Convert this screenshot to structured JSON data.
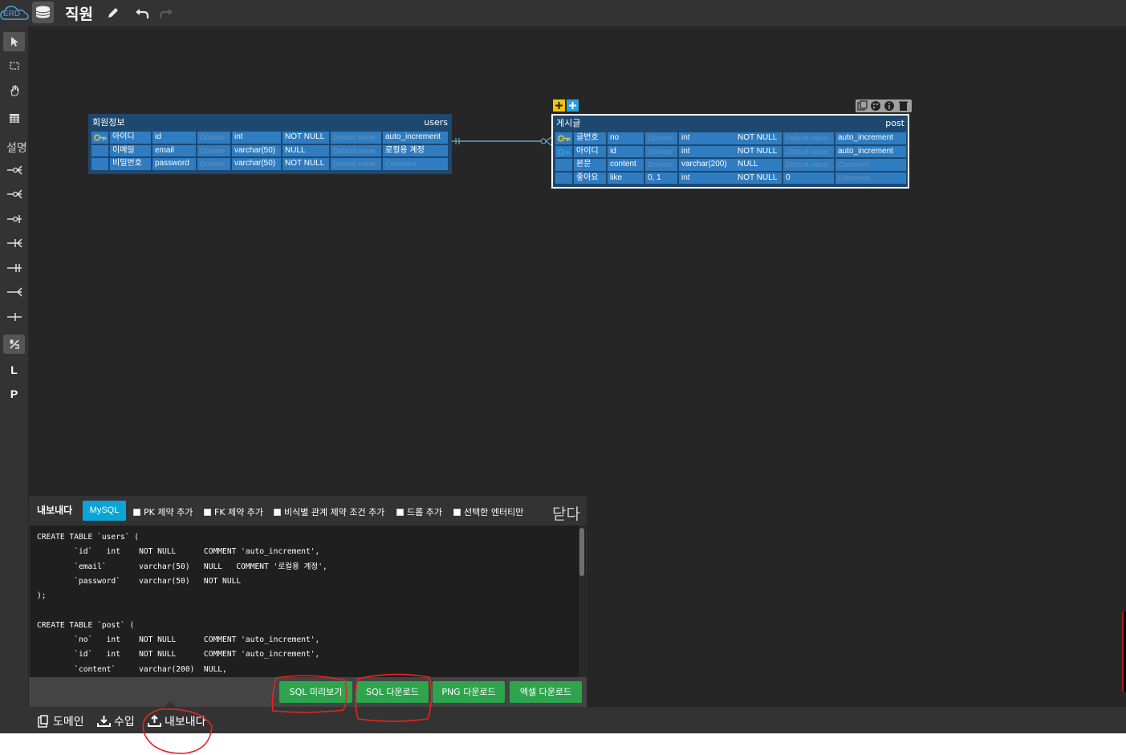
{
  "app": {
    "logo_text": "ERD",
    "document_title": "직원"
  },
  "left_toolbar": {
    "label": "설명",
    "text_items": [
      "L",
      "P"
    ]
  },
  "tables": [
    {
      "logical_name": "회원정보",
      "physical_name": "users",
      "rows": [
        {
          "key": "pk",
          "logical": "아이디",
          "name": "id",
          "domain": "Domain",
          "type": "int",
          "null": "NOT NULL",
          "default": "Default value",
          "comment": "auto_increment"
        },
        {
          "key": "",
          "logical": "이메일",
          "name": "email",
          "domain": "Domain",
          "type": "varchar(50)",
          "null": "NULL",
          "default": "Default value",
          "comment": "로컬용 계정"
        },
        {
          "key": "",
          "logical": "비밀번호",
          "name": "password",
          "domain": "Domain",
          "type": "varchar(50)",
          "null": "NOT NULL",
          "default": "Default value",
          "comment": "Comment"
        }
      ]
    },
    {
      "logical_name": "게시글",
      "physical_name": "post",
      "rows": [
        {
          "key": "pk",
          "logical": "글번호",
          "name": "no",
          "domain": "Domain",
          "type": "int",
          "null": "NOT NULL",
          "default": "Default value",
          "comment": "auto_increment"
        },
        {
          "key": "pfk",
          "logical": "아이디",
          "name": "id",
          "domain": "Domain",
          "type": "int",
          "null": "NOT NULL",
          "default": "Default value",
          "comment": "auto_increment"
        },
        {
          "key": "",
          "logical": "본문",
          "name": "content",
          "domain": "Domain",
          "type": "varchar(200)",
          "null": "NULL",
          "default": "Default value",
          "comment": "Comment"
        },
        {
          "key": "",
          "logical": "좋아요",
          "name": "like",
          "domain": "0, 1",
          "type": "int",
          "null": "NOT NULL",
          "default": "0",
          "comment": "Comment"
        }
      ]
    }
  ],
  "export_panel": {
    "title": "내보내다",
    "dialect": "MySQL",
    "options": [
      "PK 제약 추가",
      "FK 제약 추가",
      "비식별 관계 제약 조건 추가",
      "드롭 추가",
      "선택한 엔터티만"
    ],
    "close_label": "닫다",
    "sql_lines": [
      "CREATE TABLE `users` (",
      "\t`id`\tint\tNOT NULL\tCOMMENT 'auto_increment',",
      "\t`email`\tvarchar(50)\tNULL\tCOMMENT '로컬용 계정',",
      "\t`password`\tvarchar(50)\tNOT NULL",
      ");",
      "",
      "CREATE TABLE `post` (",
      "\t`no`\tint\tNOT NULL\tCOMMENT 'auto_increment',",
      "\t`id`\tint\tNOT NULL\tCOMMENT 'auto_increment',",
      "\t`content`\tvarchar(200)\tNULL,"
    ],
    "buttons": [
      "SQL 미리보기",
      "SQL 다운로드",
      "PNG 다운로드",
      "엑셀 다운로드"
    ]
  },
  "bottom_bar": {
    "tabs": [
      "도메인",
      "수입",
      "내보내다"
    ]
  },
  "colors": {
    "row_bg": "#2f7cc0",
    "table_bg": "#1d4870",
    "pk_key": "#e6c233",
    "fk_key": "#2a9fe0",
    "button_green": "#2ea44f",
    "annotation_red": "#e8241f"
  }
}
